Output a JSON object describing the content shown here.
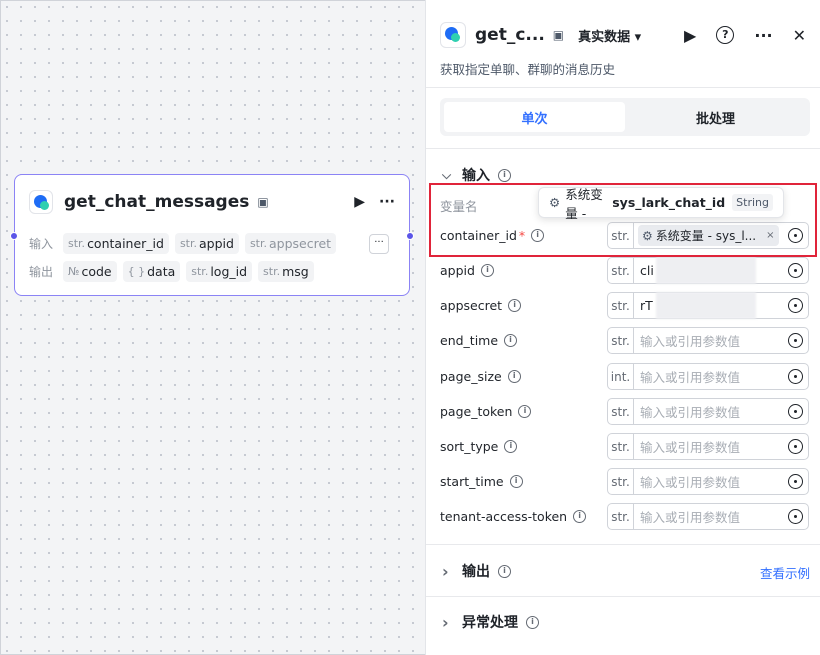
{
  "node": {
    "title": "get_chat_messages",
    "input_label": "输入",
    "output_label": "输出",
    "inputs": [
      {
        "type": "str.",
        "name": "container_id"
      },
      {
        "type": "str.",
        "name": "appid"
      },
      {
        "type": "str.",
        "name": "appsecret"
      }
    ],
    "outputs": [
      {
        "type": "№",
        "name": "code"
      },
      {
        "type": "{ }",
        "name": "data"
      },
      {
        "type": "str.",
        "name": "log_id"
      },
      {
        "type": "str.",
        "name": "msg"
      }
    ],
    "more": "···"
  },
  "panel": {
    "title": "get_c...",
    "mode": "真实数据",
    "description": "获取指定单聊、群聊的消息历史",
    "tabs": {
      "single": "单次",
      "batch": "批处理"
    },
    "input_section": "输入",
    "column_header": "变量名",
    "output_section": "输出",
    "example_link": "查看示例",
    "error_section": "异常处理",
    "placeholder": "输入或引用参数值",
    "params": [
      {
        "name": "container_id",
        "type": "str."
      },
      {
        "name": "appid",
        "type": "str.",
        "value": "cli"
      },
      {
        "name": "appsecret",
        "type": "str.",
        "value": "rT"
      },
      {
        "name": "end_time",
        "type": "str."
      },
      {
        "name": "page_size",
        "type": "int."
      },
      {
        "name": "page_token",
        "type": "str."
      },
      {
        "name": "sort_type",
        "type": "str."
      },
      {
        "name": "start_time",
        "type": "str."
      },
      {
        "name": "tenant-access-token",
        "type": "str."
      }
    ],
    "chip_text": "系统变量 - sys_l...",
    "required_mark": "*"
  },
  "tooltip": {
    "prefix": "系统变量 - ",
    "key": "sys_lark_chat_id",
    "badge": "String"
  },
  "icons": {
    "play": "▶",
    "more": "···",
    "close": "✕",
    "caret": "▾",
    "chevron_down": "⌵",
    "chevron_right": "›",
    "info": "i",
    "gear": "⚙",
    "clear": "×"
  }
}
